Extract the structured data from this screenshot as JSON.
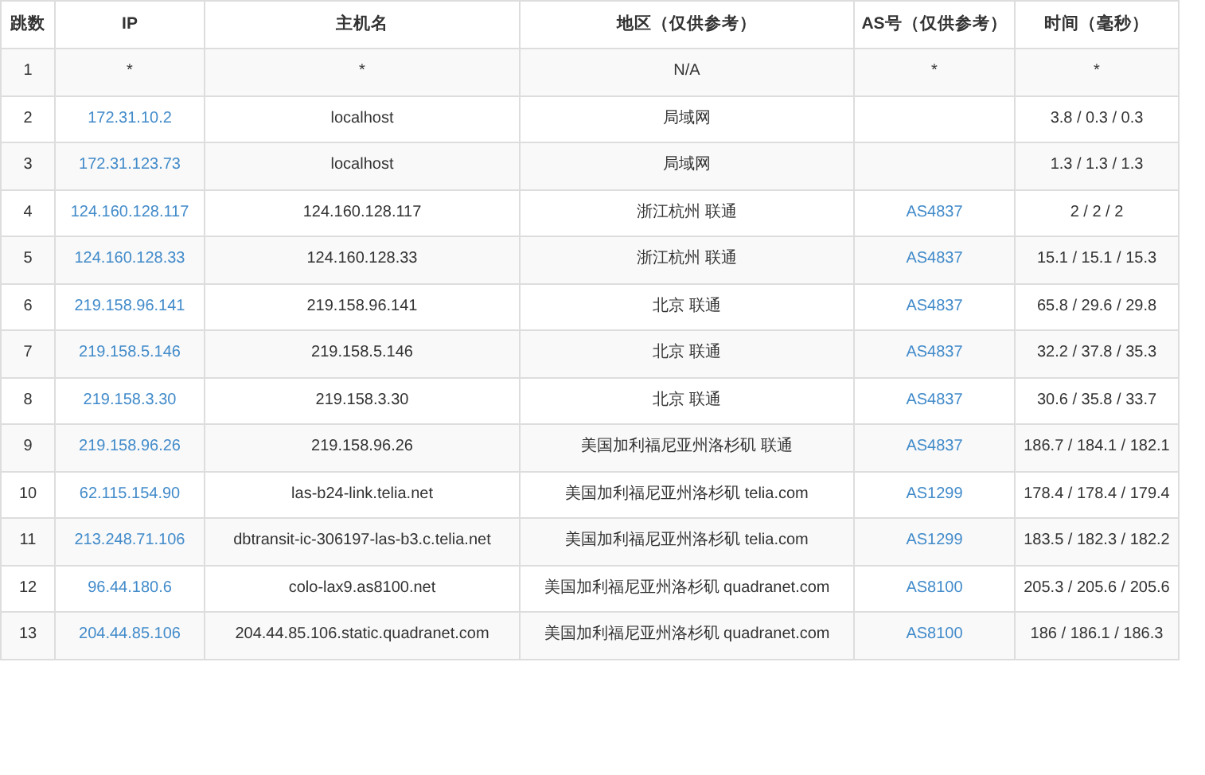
{
  "table": {
    "columns": [
      "跳数",
      "IP",
      "主机名",
      "地区（仅供参考）",
      "AS号（仅供参考）",
      "时间（毫秒）"
    ],
    "rows": [
      {
        "hop": "1",
        "ip": "*",
        "ip_link": false,
        "hostname": "*",
        "region": "N/A",
        "asn": "*",
        "asn_link": false,
        "time": "*"
      },
      {
        "hop": "2",
        "ip": "172.31.10.2",
        "ip_link": true,
        "hostname": "localhost",
        "region": "局域网",
        "time": "3.8 / 0.3 / 0.3"
      },
      {
        "hop": "3",
        "ip": "172.31.123.73",
        "ip_link": true,
        "hostname": "localhost",
        "region": "局域网",
        "time": "1.3 / 1.3 / 1.3"
      },
      {
        "hop": "4",
        "ip": "124.160.128.117",
        "ip_link": true,
        "hostname": "124.160.128.117",
        "region": "浙江杭州 联通",
        "asn": "AS4837",
        "asn_link": true,
        "time": "2 / 2 / 2"
      },
      {
        "hop": "5",
        "ip": "124.160.128.33",
        "ip_link": true,
        "hostname": "124.160.128.33",
        "region": "浙江杭州 联通",
        "asn": "AS4837",
        "asn_link": true,
        "time": "15.1 / 15.1 / 15.3"
      },
      {
        "hop": "6",
        "ip": "219.158.96.141",
        "ip_link": true,
        "hostname": "219.158.96.141",
        "region": "北京 联通",
        "asn": "AS4837",
        "asn_link": true,
        "time": "65.8 / 29.6 / 29.8"
      },
      {
        "hop": "7",
        "ip": "219.158.5.146",
        "ip_link": true,
        "hostname": "219.158.5.146",
        "region": "北京 联通",
        "asn": "AS4837",
        "asn_link": true,
        "time": "32.2 / 37.8 / 35.3"
      },
      {
        "hop": "8",
        "ip": "219.158.3.30",
        "ip_link": true,
        "hostname": "219.158.3.30",
        "region": "北京 联通",
        "asn": "AS4837",
        "asn_link": true,
        "time": "30.6 / 35.8 / 33.7"
      },
      {
        "hop": "9",
        "ip": "219.158.96.26",
        "ip_link": true,
        "hostname": "219.158.96.26",
        "region": "美国加利福尼亚州洛杉矶 联通",
        "asn": "AS4837",
        "asn_link": true,
        "time": "186.7 / 184.1 / 182.1"
      },
      {
        "hop": "10",
        "ip": "62.115.154.90",
        "ip_link": true,
        "hostname": "las-b24-link.telia.net",
        "region": "美国加利福尼亚州洛杉矶 telia.com",
        "asn": "AS1299",
        "asn_link": true,
        "time": "178.4 / 178.4 / 179.4"
      },
      {
        "hop": "11",
        "ip": "213.248.71.106",
        "ip_link": true,
        "hostname": "dbtransit-ic-306197-las-b3.c.telia.net",
        "region": "美国加利福尼亚州洛杉矶 telia.com",
        "asn": "AS1299",
        "asn_link": true,
        "time": "183.5 / 182.3 / 182.2"
      },
      {
        "hop": "12",
        "ip": "96.44.180.6",
        "ip_link": true,
        "hostname": "colo-lax9.as8100.net",
        "region": "美国加利福尼亚州洛杉矶 quadranet.com",
        "asn": "AS8100",
        "asn_link": true,
        "time": "205.3 / 205.6 / 205.6"
      },
      {
        "hop": "13",
        "ip": "204.44.85.106",
        "ip_link": true,
        "hostname": "204.44.85.106.static.quadranet.com",
        "region": "美国加利福尼亚州洛杉矶 quadranet.com",
        "asn": "AS8100",
        "asn_link": true,
        "time": "186 / 186.1 / 186.3"
      }
    ]
  }
}
